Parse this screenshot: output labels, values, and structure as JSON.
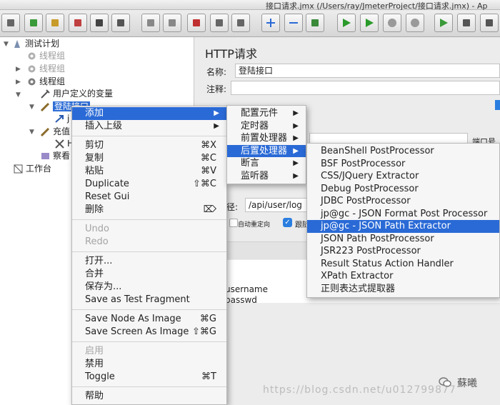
{
  "window": {
    "title": "接口请求.jmx (/Users/ray/JmeterProject/接口请求.jmx) - Ap"
  },
  "toolbar": {
    "buttons": [
      "new-icon",
      "templates-icon",
      "open-icon",
      "close-icon",
      "save-icon",
      "save-as-icon",
      "undo-icon",
      "redo-icon",
      "cut-icon",
      "copy-icon",
      "paste-icon",
      "expand-icon",
      "collapse-icon",
      "toggle-icon",
      "start-icon",
      "start-no-timers-icon",
      "stop-icon",
      "shutdown-icon",
      "remote-start-icon",
      "remote-stop-icon",
      "remote-exit-icon"
    ]
  },
  "tree": {
    "items": [
      {
        "label": "测试计划",
        "icon": "test-plan-icon"
      },
      {
        "label": "线程组",
        "icon": "gear-icon"
      },
      {
        "label": "线程组",
        "icon": "gear-icon"
      },
      {
        "label": "线程组",
        "icon": "gear-icon"
      },
      {
        "label": "用户定义的变量",
        "icon": "wrench-icon"
      },
      {
        "label": "登陆接口",
        "icon": "pencil-icon"
      },
      {
        "label": "j",
        "icon": "arrow-icon"
      },
      {
        "label": "充值",
        "icon": "pencil-icon"
      },
      {
        "label": "H",
        "icon": "wrench-icon"
      },
      {
        "label": "察看",
        "icon": "listener-icon"
      },
      {
        "label": "工作台",
        "icon": "workbench-icon"
      }
    ]
  },
  "panel": {
    "title": "HTTP请求",
    "name_label": "名称:",
    "name_value": "登陆接口",
    "comment_label": "注释:",
    "port_label": "端口号",
    "path_label": "径:",
    "path_value": "/api/user/log",
    "redirect_label": "自动重定向",
    "follow_label": "跟随",
    "param1": "username",
    "param2": "passwd"
  },
  "context_menu": {
    "items": [
      {
        "label": "添加",
        "arrow": "▶",
        "highlight": true
      },
      {
        "label": "插入上级",
        "arrow": "▶"
      },
      {
        "label": "剪切",
        "shortcut": "⌘X"
      },
      {
        "label": "复制",
        "shortcut": "⌘C"
      },
      {
        "label": "粘贴",
        "shortcut": "⌘V"
      },
      {
        "label": "Duplicate",
        "shortcut": "⇧⌘C"
      },
      {
        "label": "Reset Gui"
      },
      {
        "label": "删除",
        "shortcut": "⌦"
      },
      {
        "label": "Undo",
        "disabled": true
      },
      {
        "label": "Redo",
        "disabled": true
      },
      {
        "label": "打开..."
      },
      {
        "label": "合并"
      },
      {
        "label": "保存为..."
      },
      {
        "label": "Save as Test Fragment"
      },
      {
        "label": "Save Node As Image",
        "shortcut": "⌘G"
      },
      {
        "label": "Save Screen As Image",
        "shortcut": "⇧⌘G"
      },
      {
        "label": "启用",
        "disabled": true
      },
      {
        "label": "禁用"
      },
      {
        "label": "Toggle",
        "shortcut": "⌘T"
      },
      {
        "label": "帮助"
      }
    ]
  },
  "submenu_add": {
    "items": [
      {
        "label": "配置元件",
        "arrow": "▶"
      },
      {
        "label": "定时器",
        "arrow": "▶"
      },
      {
        "label": "前置处理器",
        "arrow": "▶"
      },
      {
        "label": "后置处理器",
        "arrow": "▶",
        "highlight": true
      },
      {
        "label": "断言",
        "arrow": "▶"
      },
      {
        "label": "监听器",
        "arrow": "▶"
      }
    ]
  },
  "submenu_post": {
    "items": [
      {
        "label": "BeanShell PostProcessor"
      },
      {
        "label": "BSF PostProcessor"
      },
      {
        "label": "CSS/JQuery Extractor"
      },
      {
        "label": "Debug PostProcessor"
      },
      {
        "label": "JDBC PostProcessor"
      },
      {
        "label": "jp@gc - JSON Format Post Processor"
      },
      {
        "label": "jp@gc - JSON Path Extractor",
        "highlight": true
      },
      {
        "label": "JSON Path PostProcessor"
      },
      {
        "label": "JSR223 PostProcessor"
      },
      {
        "label": "Result Status Action Handler"
      },
      {
        "label": "XPath Extractor"
      },
      {
        "label": "正则表达式提取器"
      }
    ]
  },
  "watermark": {
    "url": "https://blog.csdn.net/u012799877",
    "name": "蘇曦"
  },
  "colors": {
    "highlight": "#2a6ad6",
    "tree_selection": "#2f6ed6"
  }
}
